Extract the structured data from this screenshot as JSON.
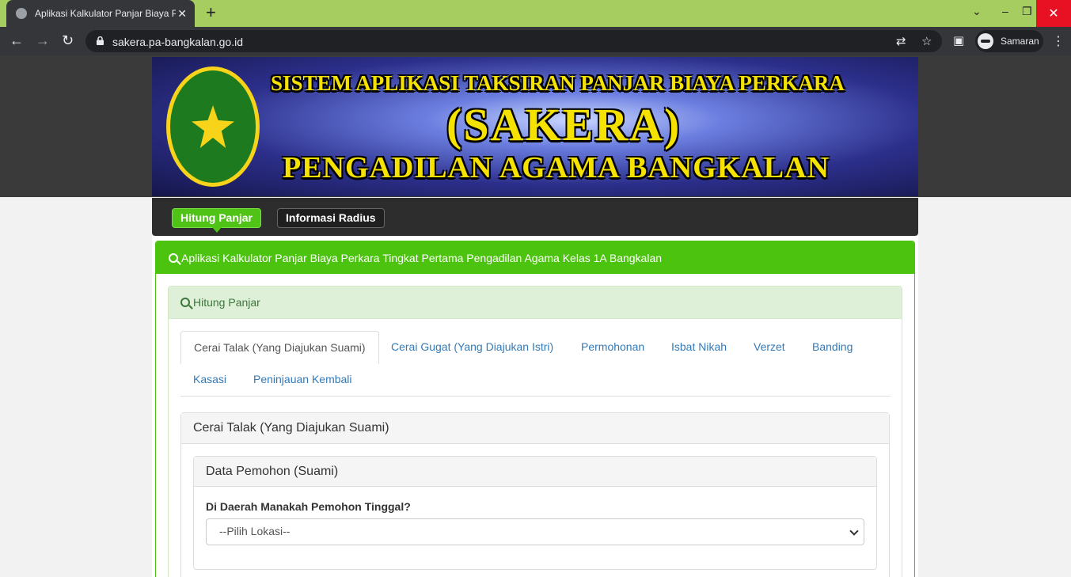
{
  "browser": {
    "tab_title": "Aplikasi Kalkulator Panjar Biaya Perkara",
    "tab_close": "✕",
    "new_tab": "+",
    "url": "sakera.pa-bangkalan.go.id",
    "profile_name": "Samaran",
    "window_dropdown": "⌄",
    "window_minimize": "–",
    "window_restore": "❐",
    "window_close": "✕",
    "back": "←",
    "forward": "→",
    "reload": "↻",
    "translate": "⇄",
    "bookmark": "☆",
    "sidepanel": "▣",
    "menu": "⋮"
  },
  "banner": {
    "line1": "SISTEM APLIKASI TAKSIRAN PANJAR BIAYA PERKARA",
    "line2": "(SAKERA)",
    "line3": "PENGADILAN AGAMA BANGKALAN"
  },
  "nav": {
    "items": [
      {
        "label": "Hitung Panjar",
        "active": true
      },
      {
        "label": "Informasi Radius",
        "active": false
      }
    ]
  },
  "main": {
    "panel_title": "Aplikasi Kalkulator Panjar Biaya Perkara Tingkat Pertama Pengadilan Agama Kelas 1A Bangkalan",
    "sub_panel_title": "Hitung Panjar",
    "tabs": [
      {
        "label": "Cerai Talak (Yang Diajukan Suami)"
      },
      {
        "label": "Cerai Gugat (Yang Diajukan Istri)"
      },
      {
        "label": "Permohonan"
      },
      {
        "label": "Isbat Nikah"
      },
      {
        "label": "Verzet"
      },
      {
        "label": "Banding"
      },
      {
        "label": "Kasasi"
      },
      {
        "label": "Peninjauan Kembali"
      }
    ],
    "case_title": "Cerai Talak (Yang Diajukan Suami)",
    "data_title": "Data Pemohon (Suami)",
    "question": "Di Daerah Manakah Pemohon Tinggal?",
    "select_value": "--Pilih Lokasi--"
  },
  "colors": {
    "tab_strip": "#a5cd5f",
    "accent_green": "#4cc30e",
    "link_blue": "#337ab7"
  }
}
